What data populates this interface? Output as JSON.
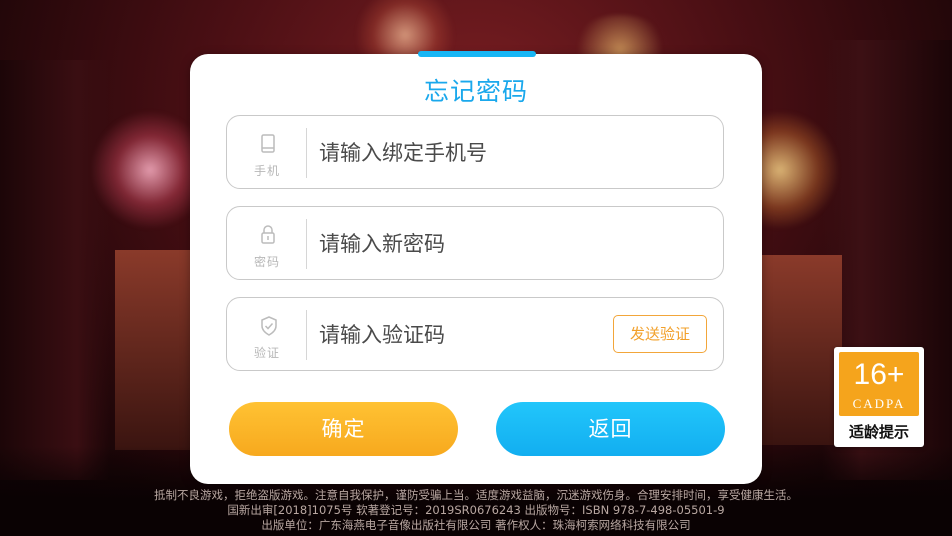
{
  "dialog": {
    "title": "忘记密码",
    "phone": {
      "icon_label": "手机",
      "placeholder": "请输入绑定手机号"
    },
    "password": {
      "icon_label": "密码",
      "placeholder": "请输入新密码"
    },
    "code": {
      "icon_label": "验证",
      "placeholder": "请输入验证码",
      "send_label": "发送验证"
    },
    "confirm_label": "确定",
    "back_label": "返回"
  },
  "age_rating": {
    "age": "16+",
    "org": "CADPA",
    "label": "适龄提示"
  },
  "footer": {
    "line1": "抵制不良游戏，拒绝盗版游戏。注意自我保护，谨防受骗上当。适度游戏益脑，沉迷游戏伤身。合理安排时间，享受健康生活。",
    "line2": "国新出审[2018]1075号  软著登记号：2019SR0676243  出版物号：ISBN 978-7-498-05501-9",
    "line3": "出版单位：广东海燕电子音像出版社有限公司    著作权人：珠海柯索网络科技有限公司"
  },
  "colors": {
    "accent": "#17b6f5",
    "confirm": "#f7a91e",
    "send": "#f2a02a"
  }
}
